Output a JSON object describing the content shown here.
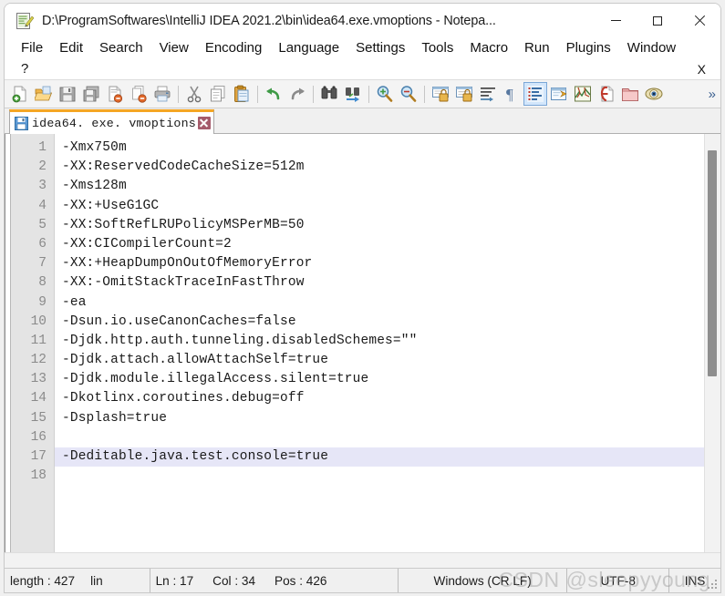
{
  "window": {
    "title": "D:\\ProgramSoftwares\\IntelliJ IDEA 2021.2\\bin\\idea64.exe.vmoptions - Notepa...",
    "icon": "notepadpp-icon",
    "controls": {
      "minimize": "minimize-button",
      "maximize": "maximize-button",
      "close": "close-button"
    }
  },
  "menu": {
    "row1": [
      "File",
      "Edit",
      "Search",
      "View",
      "Encoding",
      "Language",
      "Settings",
      "Tools",
      "Macro",
      "Run",
      "Plugins",
      "Window"
    ],
    "row2_left": "?",
    "row2_right": "X"
  },
  "toolbar": {
    "overflow": "»",
    "buttons": [
      {
        "name": "new-file-icon",
        "title": "New"
      },
      {
        "name": "open-folder-icon",
        "title": "Open"
      },
      {
        "name": "save-icon",
        "title": "Save"
      },
      {
        "name": "save-all-icon",
        "title": "Save All"
      },
      {
        "name": "close-file-icon",
        "title": "Close"
      },
      {
        "name": "close-all-icon",
        "title": "Close All"
      },
      {
        "name": "print-icon",
        "title": "Print"
      },
      {
        "name": "separator",
        "title": ""
      },
      {
        "name": "cut-icon",
        "title": "Cut"
      },
      {
        "name": "copy-icon",
        "title": "Copy"
      },
      {
        "name": "paste-icon",
        "title": "Paste"
      },
      {
        "name": "separator",
        "title": ""
      },
      {
        "name": "undo-icon",
        "title": "Undo"
      },
      {
        "name": "redo-icon",
        "title": "Redo"
      },
      {
        "name": "separator",
        "title": ""
      },
      {
        "name": "find-icon",
        "title": "Find"
      },
      {
        "name": "replace-icon",
        "title": "Replace"
      },
      {
        "name": "separator",
        "title": ""
      },
      {
        "name": "zoom-in-icon",
        "title": "Zoom In"
      },
      {
        "name": "zoom-out-icon",
        "title": "Zoom Out"
      },
      {
        "name": "separator",
        "title": ""
      },
      {
        "name": "sync-vertical-icon",
        "title": "Synchronize Vertical Scrolling"
      },
      {
        "name": "sync-horizontal-icon",
        "title": "Synchronize Horizontal Scrolling"
      },
      {
        "name": "word-wrap-icon",
        "title": "Word wrap"
      },
      {
        "name": "show-all-chars-icon",
        "title": "Show All Characters"
      },
      {
        "name": "show-indent-guide-icon",
        "title": "Show Indent Guide",
        "active": true
      },
      {
        "name": "user-defined-dialog-icon",
        "title": "User Defined Dialogue"
      },
      {
        "name": "document-map-icon",
        "title": "Document Map"
      },
      {
        "name": "function-list-icon",
        "title": "Function List"
      },
      {
        "name": "folder-workspace-icon",
        "title": "Folder as Workspace"
      },
      {
        "name": "monitoring-icon",
        "title": "Monitoring"
      }
    ]
  },
  "tabs": [
    {
      "label": "idea64. exe. vmoptions",
      "icon": "saved-floppy-icon",
      "close": "tab-close-icon",
      "active": true
    }
  ],
  "editor": {
    "line_count": 18,
    "highlight_line": 17,
    "caret_line": 17,
    "caret_col": 34,
    "lines": [
      {
        "n": 1,
        "text": "-Xmx750m"
      },
      {
        "n": 2,
        "text": "-XX:ReservedCodeCacheSize=512m"
      },
      {
        "n": 3,
        "text": "-Xms128m"
      },
      {
        "n": 4,
        "text": "-XX:+UseG1GC"
      },
      {
        "n": 5,
        "text": "-XX:SoftRefLRUPolicyMSPerMB=50"
      },
      {
        "n": 6,
        "text": "-XX:CICompilerCount=2"
      },
      {
        "n": 7,
        "text": "-XX:+HeapDumpOnOutOfMemoryError"
      },
      {
        "n": 8,
        "text": "-XX:-OmitStackTraceInFastThrow"
      },
      {
        "n": 9,
        "text": "-ea"
      },
      {
        "n": 10,
        "text": "-Dsun.io.useCanonCaches=false"
      },
      {
        "n": 11,
        "text": "-Djdk.http.auth.tunneling.disabledSchemes=\"\""
      },
      {
        "n": 12,
        "text": "-Djdk.attach.allowAttachSelf=true"
      },
      {
        "n": 13,
        "text": "-Djdk.module.illegalAccess.silent=true"
      },
      {
        "n": 14,
        "text": "-Dkotlinx.coroutines.debug=off"
      },
      {
        "n": 15,
        "text": "-Dsplash=true"
      },
      {
        "n": 16,
        "text": ""
      },
      {
        "n": 17,
        "text": "-Deditable.java.test.console=true"
      },
      {
        "n": 18,
        "text": ""
      }
    ]
  },
  "statusbar": {
    "length_label": "length : 427",
    "lines_label": "lin",
    "ln": "Ln : 17",
    "col": "Col : 34",
    "pos": "Pos : 426",
    "eol": "Windows (CR LF)",
    "encoding": "UTF-8",
    "insert_mode": "INS"
  },
  "watermark": "CSDN @sleepyyoung",
  "colors": {
    "tab_accent": "#f5a623",
    "gutter_bg": "#e4e4e4",
    "highlight_line_bg": "#e6e6f7",
    "statusbar_bg": "#f0f0f0",
    "toolbar_bg": "#f4f4f4"
  }
}
